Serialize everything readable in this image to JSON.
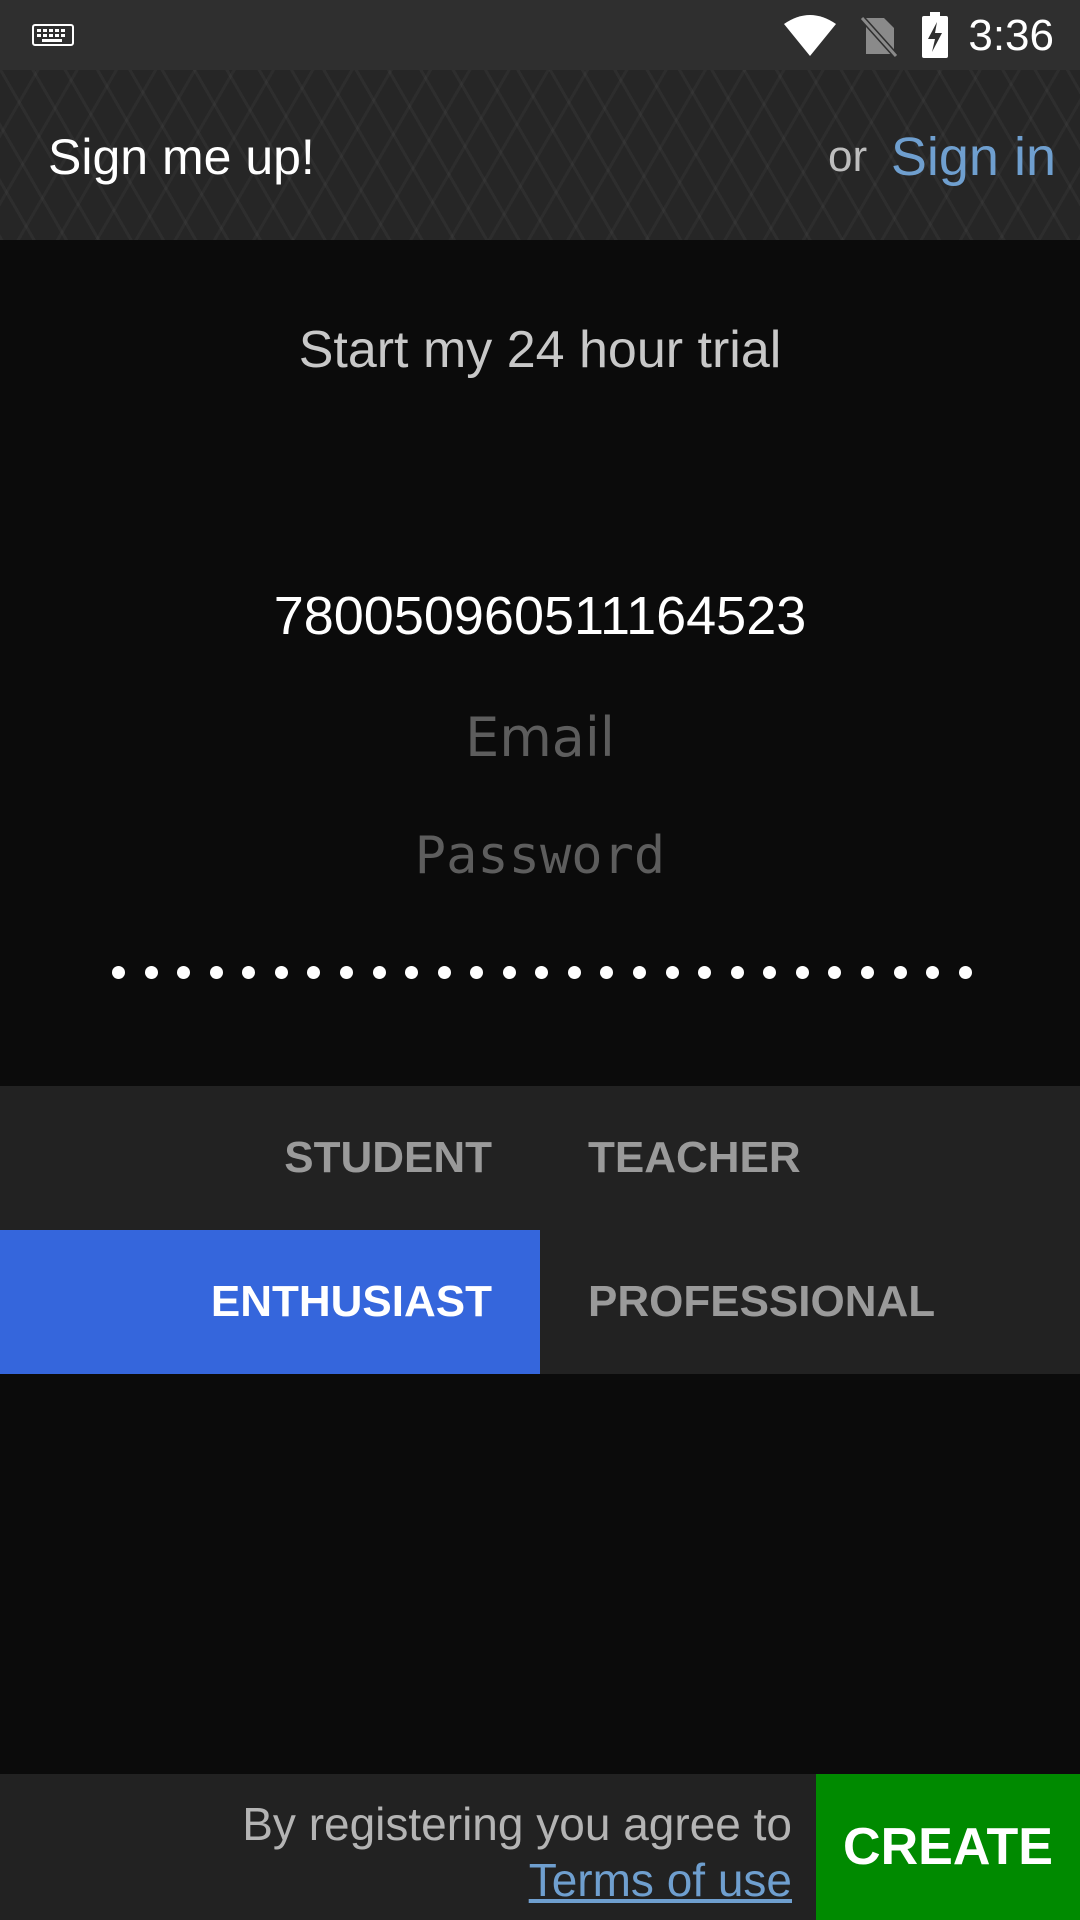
{
  "status_bar": {
    "time": "3:36",
    "icons": [
      "keyboard-icon",
      "wifi-icon",
      "no-sim-icon",
      "battery-charging-icon"
    ]
  },
  "header": {
    "title": "Sign me up!",
    "or_text": "or",
    "sign_in_label": "Sign in"
  },
  "form": {
    "heading": "Start my 24 hour trial",
    "username_value": "780050960511164523",
    "email_placeholder": "Email",
    "password_placeholder": "Password",
    "confirm_password_length": 27
  },
  "roles": {
    "options": [
      "STUDENT",
      "TEACHER",
      "ENTHUSIAST",
      "PROFESSIONAL"
    ],
    "selected": "ENTHUSIAST"
  },
  "footer": {
    "agree_text": "By registering you agree to",
    "terms_label": "Terms of use",
    "create_label": "CREATE"
  },
  "colors": {
    "accent_link": "#6f9fcf",
    "selected_role": "#3566dc",
    "create_button": "#008a00"
  }
}
